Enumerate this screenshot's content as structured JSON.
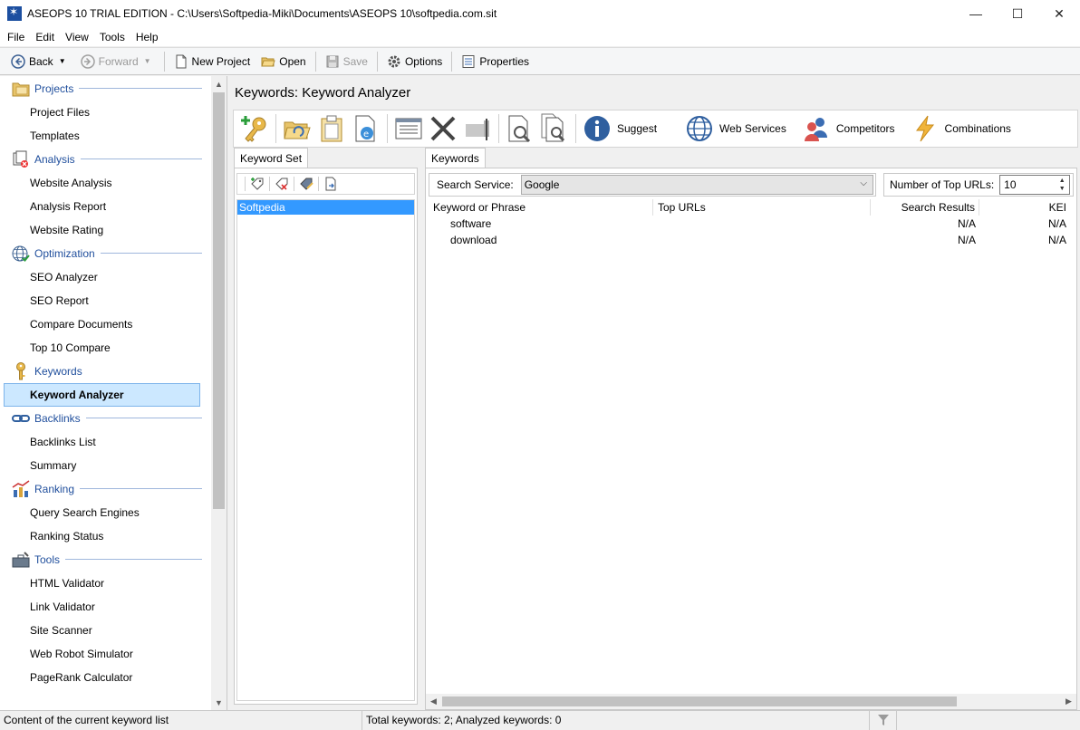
{
  "window": {
    "title": "ASEOPS 10 TRIAL EDITION - C:\\Users\\Softpedia-Miki\\Documents\\ASEOPS 10\\softpedia.com.sit",
    "minimize": "—",
    "maximize": "☐",
    "close": "✕"
  },
  "menu": [
    "File",
    "Edit",
    "View",
    "Tools",
    "Help"
  ],
  "toolbar": {
    "back": "Back",
    "forward": "Forward",
    "new_project": "New Project",
    "open": "Open",
    "save": "Save",
    "options": "Options",
    "properties": "Properties"
  },
  "sidebar": {
    "groups": [
      {
        "label": "Projects",
        "icon": "folder-icon",
        "items": [
          "Project Files",
          "Templates"
        ]
      },
      {
        "label": "Analysis",
        "icon": "analysis-icon",
        "items": [
          "Website Analysis",
          "Analysis Report",
          "Website Rating"
        ]
      },
      {
        "label": "Optimization",
        "icon": "globe-check-icon",
        "items": [
          "SEO Analyzer",
          "SEO Report",
          "Compare Documents",
          "Top 10 Compare"
        ]
      },
      {
        "label": "Keywords",
        "icon": "key-icon",
        "items": [
          "Keyword Analyzer"
        ]
      },
      {
        "label": "Backlinks",
        "icon": "chain-link-icon",
        "items": [
          "Backlinks List",
          "Summary"
        ]
      },
      {
        "label": "Ranking",
        "icon": "ranking-chart-icon",
        "items": [
          "Query Search Engines",
          "Ranking Status"
        ]
      },
      {
        "label": "Tools",
        "icon": "toolbox-icon",
        "items": [
          "HTML Validator",
          "Link Validator",
          "Site Scanner",
          "Web Robot Simulator",
          "PageRank Calculator"
        ]
      }
    ],
    "selected": "Keyword Analyzer"
  },
  "main": {
    "title": "Keywords: Keyword Analyzer",
    "ribbon": {
      "suggest": "Suggest",
      "web_services": "Web Services",
      "competitors": "Competitors",
      "combinations": "Combinations"
    },
    "keyword_set": {
      "tab": "Keyword Set",
      "items": [
        "Softpedia"
      ]
    },
    "keywords": {
      "tab": "Keywords",
      "search_service_label": "Search Service:",
      "search_service_value": "Google",
      "top_urls_label": "Number of Top URLs:",
      "top_urls_value": "10",
      "columns": [
        "Keyword or Phrase",
        "Top URLs",
        "Search Results",
        "KEI"
      ],
      "rows": [
        {
          "keyword": "software",
          "top_urls": "",
          "search_results": "N/A",
          "kei": "N/A"
        },
        {
          "keyword": "download",
          "top_urls": "",
          "search_results": "N/A",
          "kei": "N/A"
        }
      ]
    }
  },
  "status": {
    "left": "Content of the current keyword list",
    "middle": "Total keywords: 2; Analyzed keywords: 0"
  },
  "colors": {
    "accent": "#1f4e9c",
    "selection": "#3399ff",
    "selected_nav": "#cce8ff"
  }
}
